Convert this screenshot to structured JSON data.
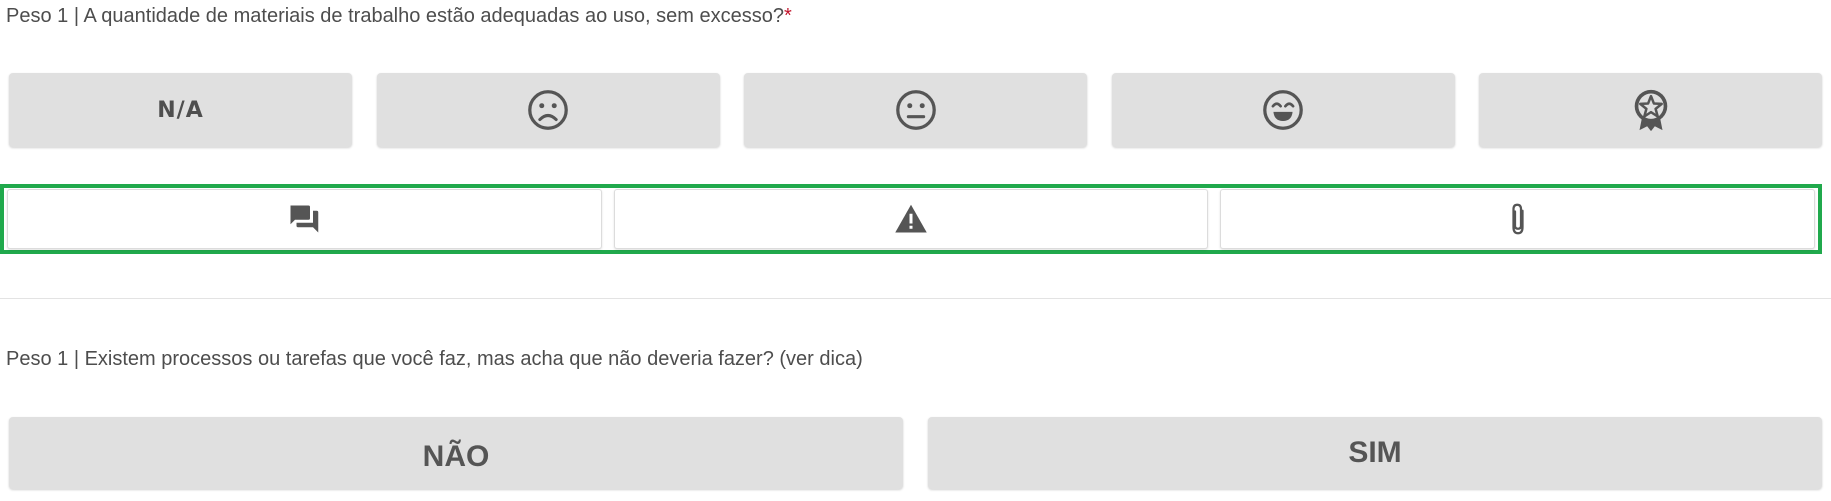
{
  "question1": {
    "text": "Peso 1 | A quantidade de materiais de trabalho estão adequadas ao uso, sem excesso?",
    "required_marker": "*",
    "options": [
      {
        "label": "N/A",
        "icon": "na-text"
      },
      {
        "icon": "sad-face-icon"
      },
      {
        "icon": "neutral-face-icon"
      },
      {
        "icon": "happy-face-icon"
      },
      {
        "icon": "award-star-icon"
      }
    ],
    "actions": [
      {
        "icon": "comment-icon"
      },
      {
        "icon": "warning-icon"
      },
      {
        "icon": "attachment-icon"
      }
    ],
    "highlight_color": "#20a94c"
  },
  "question2": {
    "text": "Peso 1 | Existem processos ou tarefas que você faz, mas acha que não deveria fazer? (ver dica)",
    "no_label": "NÃO",
    "yes_label": "SIM"
  },
  "colors": {
    "button_bg": "#e0e0e0",
    "required": "#c2142b"
  }
}
